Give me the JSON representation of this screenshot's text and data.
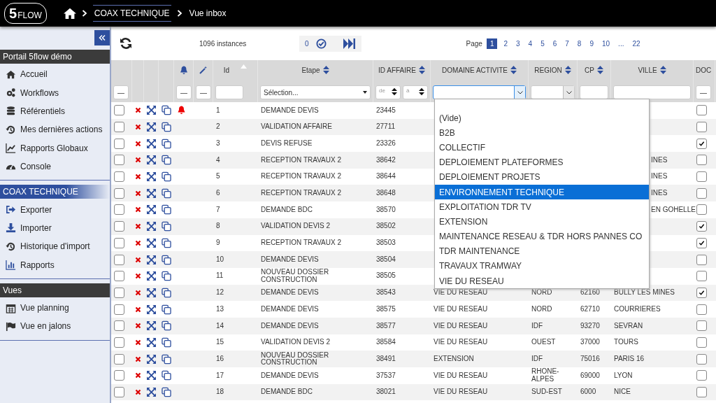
{
  "logo": {
    "number": "5",
    "word": "FLOW"
  },
  "breadcrumb": [
    {
      "label": "COAX TECHNIQUE",
      "selected": true
    },
    {
      "label": "Vue inbox",
      "selected": false
    }
  ],
  "sidebar": {
    "sections": [
      {
        "title": "Portail 5flow démo",
        "kind": "dark",
        "items": [
          {
            "label": "Accueil",
            "kind": "home"
          },
          {
            "label": "Workflows",
            "kind": "gears"
          },
          {
            "label": "Référentiels",
            "kind": "database"
          },
          {
            "label": "Mes dernières actions",
            "kind": "history"
          },
          {
            "label": "Rapports Globaux",
            "kind": "chart"
          },
          {
            "label": "Console",
            "kind": "gauge"
          }
        ]
      },
      {
        "title": "COAX TECHNIQUE",
        "kind": "blue",
        "items": [
          {
            "label": "Exporter",
            "kind": "export"
          },
          {
            "label": "Importer",
            "kind": "download"
          },
          {
            "label": "Historique d'import",
            "kind": "history"
          },
          {
            "label": "Rapports",
            "kind": "bars"
          }
        ]
      },
      {
        "title": "Vues",
        "kind": "dark",
        "items": [
          {
            "label": "Vue planning",
            "kind": "calendar"
          },
          {
            "label": "Vue en jalons",
            "kind": "flag"
          }
        ]
      }
    ]
  },
  "toolbar": {
    "count": "1096 instances",
    "selected_count": "0",
    "page_label": "Page",
    "pages": [
      {
        "label": "1",
        "selected": true
      },
      {
        "label": "2",
        "selected": false
      },
      {
        "label": "3",
        "selected": false
      },
      {
        "label": "4",
        "selected": false
      },
      {
        "label": "5",
        "selected": false
      },
      {
        "label": "6",
        "selected": false
      },
      {
        "label": "7",
        "selected": false
      },
      {
        "label": "8",
        "selected": false
      },
      {
        "label": "9",
        "selected": false
      },
      {
        "label": "10",
        "selected": false
      },
      {
        "label": "...",
        "selected": false
      },
      {
        "label": "22",
        "selected": false
      }
    ]
  },
  "table": {
    "columns": [
      "Id",
      "Etape",
      "ID AFFAIRE",
      "DOMAINE ACTIVITE",
      "REGION",
      "CP",
      "VILLE",
      "DOC"
    ],
    "filters": {
      "tri_state": "—",
      "etape_placeholder": "Sélection...",
      "from_placeholder": "de",
      "to_placeholder": "à"
    },
    "rows": [
      {
        "checked": false,
        "id": "1",
        "etape": "DEMANDE DEVIS",
        "affaire": "23445",
        "alert": true,
        "doc_checked": false
      },
      {
        "checked": false,
        "id": "2",
        "etape": "VALIDATION AFFAIRE",
        "affaire": "27711",
        "alert": false,
        "doc_checked": false
      },
      {
        "checked": false,
        "id": "3",
        "etape": "DEVIS REFUSE",
        "affaire": "23326",
        "alert": false,
        "doc_checked": true
      },
      {
        "checked": false,
        "id": "4",
        "etape": "RECEPTION TRAVAUX 2",
        "affaire": "38642",
        "alert": false,
        "ville": "INES",
        "doc_checked": false
      },
      {
        "checked": false,
        "id": "5",
        "etape": "RECEPTION TRAVAUX 2",
        "affaire": "38644",
        "alert": false,
        "ville": "INES",
        "doc_checked": false
      },
      {
        "checked": false,
        "id": "6",
        "etape": "RECEPTION TRAVAUX 2",
        "affaire": "38648",
        "alert": false,
        "ville": "INES",
        "doc_checked": false
      },
      {
        "checked": false,
        "id": "7",
        "etape": "DEMANDE BDC",
        "affaire": "38570",
        "alert": false,
        "ville": "EN GOHELLE",
        "doc_checked": false
      },
      {
        "checked": false,
        "id": "8",
        "etape": "VALIDATION DEVIS 2",
        "affaire": "38502",
        "alert": false,
        "doc_checked": true
      },
      {
        "checked": false,
        "id": "9",
        "etape": "RECEPTION TRAVAUX 2",
        "affaire": "38503",
        "alert": false,
        "doc_checked": true
      },
      {
        "checked": false,
        "id": "10",
        "etape": "DEMANDE DEVIS",
        "affaire": "38504",
        "alert": false,
        "doc_checked": false
      },
      {
        "checked": false,
        "id": "11",
        "etape": "NOUVEAU DOSSIER CONSTRUCTION",
        "affaire": "38505",
        "alert": false,
        "doc_checked": false
      },
      {
        "checked": false,
        "id": "12",
        "etape": "DEMANDE DEVIS",
        "affaire": "38543",
        "alert": false,
        "domaine": "VIE DU RESEAU",
        "region": "NORD",
        "cp": "62160",
        "ville": "BULLY LES MINES",
        "doc_checked": true
      },
      {
        "checked": false,
        "id": "13",
        "etape": "DEMANDE DEVIS",
        "affaire": "38575",
        "alert": false,
        "domaine": "VIE DU RESEAU",
        "region": "NORD",
        "cp": "62710",
        "ville": "COURRIERES",
        "doc_checked": false
      },
      {
        "checked": false,
        "id": "14",
        "etape": "DEMANDE DEVIS",
        "affaire": "38577",
        "alert": false,
        "domaine": "VIE DU RESEAU",
        "region": "IDF",
        "cp": "93270",
        "ville": "SEVRAN",
        "doc_checked": false
      },
      {
        "checked": false,
        "id": "15",
        "etape": "VALIDATION DEVIS 2",
        "affaire": "38584",
        "alert": false,
        "domaine": "VIE DU RESEAU",
        "region": "OUEST",
        "cp": "37000",
        "ville": "TOURS",
        "doc_checked": false
      },
      {
        "checked": false,
        "id": "16",
        "etape": "NOUVEAU DOSSIER CONSTRUCTION",
        "affaire": "38491",
        "alert": false,
        "domaine": "EXTENSION",
        "region": "IDF",
        "cp": "75016",
        "ville": "PARIS 16",
        "doc_checked": false
      },
      {
        "checked": false,
        "id": "17",
        "etape": "DEMANDE DEVIS",
        "affaire": "37537",
        "alert": false,
        "domaine": "VIE DU RESEAU",
        "region": "RHONE-ALPES",
        "cp": "69000",
        "ville": "LYON",
        "doc_checked": false
      },
      {
        "checked": false,
        "id": "18",
        "etape": "DEMANDE BDC",
        "affaire": "38021",
        "alert": false,
        "domaine": "VIE DU RESEAU",
        "region": "SUD-EST",
        "cp": "6000",
        "ville": "NICE",
        "doc_checked": false
      }
    ]
  },
  "dropdown": {
    "options": [
      {
        "label": "(Vide)",
        "selected": false
      },
      {
        "label": "B2B",
        "selected": false
      },
      {
        "label": "COLLECTIF",
        "selected": false
      },
      {
        "label": "DEPLOIEMENT PLATEFORMES",
        "selected": false
      },
      {
        "label": "DEPLOIEMENT PROJETS",
        "selected": false
      },
      {
        "label": "ENVIRONNEMENT TECHNIQUE",
        "selected": true
      },
      {
        "label": "EXPLOITATION TDR TV",
        "selected": false
      },
      {
        "label": "EXTENSION",
        "selected": false
      },
      {
        "label": "MAINTENANCE RESEAU & TDR HORS PANNES CO",
        "selected": false
      },
      {
        "label": "TDR MAINTENANCE",
        "selected": false
      },
      {
        "label": "TRAVAUX TRAMWAY",
        "selected": false
      },
      {
        "label": "VIE DU RESEAU",
        "selected": false
      }
    ]
  }
}
